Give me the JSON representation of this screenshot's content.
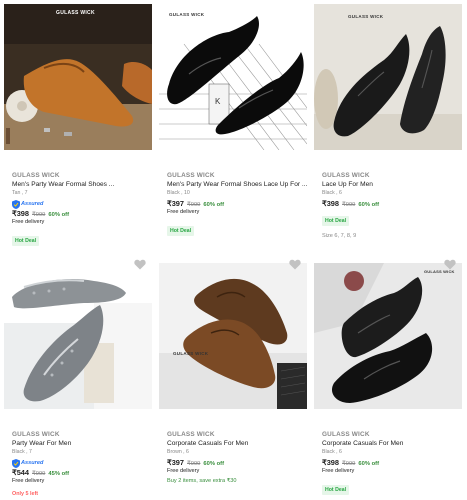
{
  "colors": {
    "price_off": "#388e3c",
    "hot_deal_bg": "#e6f6e9",
    "hot_deal_text": "#26a541",
    "assured": "#2874f0",
    "low_stock": "#ff6161",
    "muted": "#878787"
  },
  "products": [
    {
      "image_logo": "GULASS WICK",
      "brand": "GULASS WICK",
      "title": "Men's Party Wear Formal Shoes ...",
      "meta": "Tan , 7",
      "assured": "Assured",
      "price": "₹398",
      "mrp": "₹999",
      "off": "60% off",
      "delivery": "Free delivery",
      "deal": "Hot Deal"
    },
    {
      "image_logo": "GULASS WICK",
      "brand": "GULASS WICK",
      "title": "Men's Party Wear Formal Shoes Lace Up For ...",
      "meta": "Black , 10",
      "price": "₹397",
      "mrp": "₹999",
      "off": "60% off",
      "delivery": "Free delivery",
      "deal": "Hot Deal"
    },
    {
      "image_logo": "GULASS WICK",
      "brand": "GULASS WICK",
      "title": "Lace Up For Men",
      "meta": "Black , 6",
      "price": "₹398",
      "mrp": "₹999",
      "off": "60% off",
      "deal": "Hot Deal",
      "sizes": "Size 6, 7, 8, 9"
    },
    {
      "brand": "GULASS WICK",
      "title": "Party Wear For Men",
      "meta": "Black , 7",
      "assured": "Assured",
      "price": "₹544",
      "mrp": "₹999",
      "off": "45% off",
      "delivery": "Free delivery",
      "left": "Only 5 left"
    },
    {
      "image_logo": "GULASS WICK",
      "brand": "GULASS WICK",
      "title": "Corporate Casuals For Men",
      "meta": "Brown , 6",
      "price": "₹397",
      "mrp": "₹999",
      "off": "60% off",
      "delivery": "Free delivery",
      "offer": "Buy 2 items, save extra ₹30"
    },
    {
      "image_logo": "GULASS WICK",
      "brand": "GULASS WICK",
      "title": "Corporate Casuals For Men",
      "meta": "Black , 6",
      "price": "₹398",
      "mrp": "₹999",
      "off": "60% off",
      "delivery": "Free delivery",
      "deal": "Hot Deal"
    }
  ],
  "icons": {
    "wishlist": "heart-icon",
    "assured": "assured-shield-icon"
  }
}
